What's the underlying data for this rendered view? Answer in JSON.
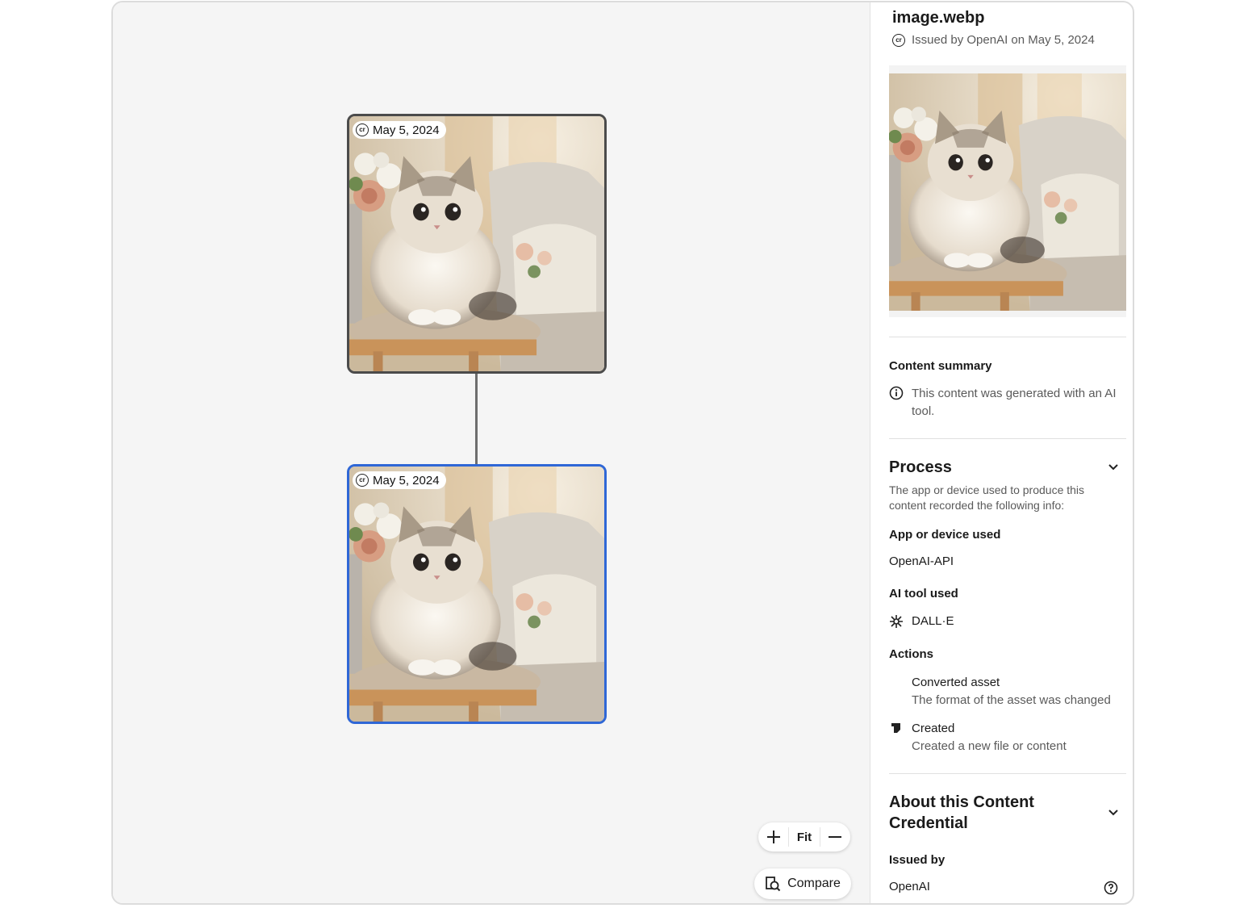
{
  "canvas": {
    "nodes": [
      {
        "date": "May 5, 2024",
        "selected": false
      },
      {
        "date": "May 5, 2024",
        "selected": true
      }
    ],
    "zoom": {
      "zoom_in_icon": "plus-icon",
      "fit_label": "Fit",
      "zoom_out_icon": "minus-icon"
    },
    "compare_label": "Compare"
  },
  "panel": {
    "file_name": "image.webp",
    "issued_line": "Issued by OpenAI on May 5, 2024",
    "content_summary": {
      "heading": "Content summary",
      "text": "This content was generated with an AI tool."
    },
    "process": {
      "heading": "Process",
      "description": "The app or device used to produce this content recorded the following info:",
      "app_label": "App or device used",
      "app_value": "OpenAI-API",
      "ai_tool_label": "AI tool used",
      "ai_tool_value": "DALL·E",
      "actions_label": "Actions",
      "actions": [
        {
          "title": "Converted asset",
          "description": "The format of the asset was changed"
        },
        {
          "title": "Created",
          "description": "Created a new file or content"
        }
      ]
    },
    "about": {
      "heading": "About this Content Credential",
      "issued_by_label": "Issued by",
      "issued_by_value": "OpenAI"
    }
  },
  "colors": {
    "selected_border": "#2f67d6",
    "node_border": "#4b4b4b",
    "canvas_bg": "#f5f5f5"
  }
}
